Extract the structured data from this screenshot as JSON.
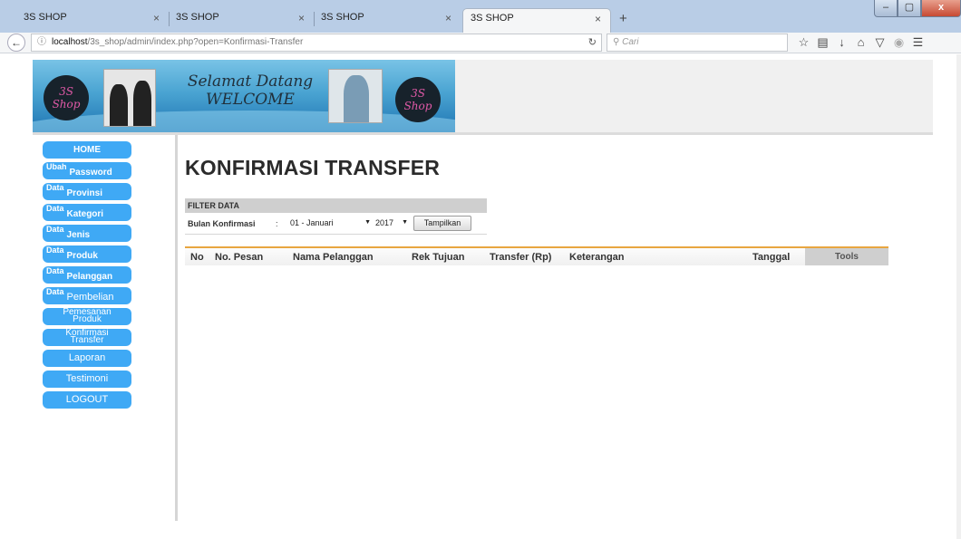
{
  "browser": {
    "tabs": [
      {
        "title": "3S SHOP",
        "close": "×"
      },
      {
        "title": "3S SHOP",
        "close": "×"
      },
      {
        "title": "3S SHOP",
        "close": "×"
      },
      {
        "title": "3S SHOP",
        "close": "×"
      }
    ],
    "new_tab": "+",
    "window_buttons": {
      "minimize": "–",
      "maximize": "▢",
      "close": "x"
    },
    "url_host": "localhost",
    "url_path": "/3s_shop/admin/index.php?open=Konfirmasi-Transfer",
    "search_placeholder": "Cari",
    "icons": [
      "back-icon",
      "info-icon",
      "reload-icon",
      "search-icon",
      "star-icon",
      "bookmarks-icon",
      "download-icon",
      "home-icon",
      "pocket-icon",
      "extension-icon",
      "menu-icon"
    ]
  },
  "banner": {
    "logo_text_line1": "3S",
    "logo_text_line2": "Shop",
    "welcome_line1": "Selamat Datang",
    "welcome_line2": "WELCOME"
  },
  "sidebar": {
    "items": [
      {
        "label": "HOME"
      },
      {
        "pre": "Ubah",
        "main": "Password"
      },
      {
        "pre": "Data",
        "main": "Provinsi"
      },
      {
        "pre": "Data",
        "main": "Kategori"
      },
      {
        "pre": "Data",
        "main": "Jenis"
      },
      {
        "pre": "Data",
        "main": "Produk"
      },
      {
        "pre": "Data",
        "main": "Pelanggan"
      },
      {
        "pre": "Data",
        "main": "Pembelian"
      },
      {
        "line1": "Pemesanan",
        "line2": "Produk"
      },
      {
        "line1": "Konfirmasi",
        "line2": "Transfer"
      },
      {
        "label": "Laporan"
      },
      {
        "label": "Testimoni"
      },
      {
        "label": "LOGOUT"
      }
    ]
  },
  "main": {
    "title": "KONFIRMASI TRANSFER",
    "filter": {
      "header": "FILTER DATA",
      "label": "Bulan Konfirmasi",
      "colon": ":",
      "month_value": "01 - Januari",
      "year_value": "2017",
      "button": "Tampilkan"
    },
    "table": {
      "columns": [
        "No",
        "No. Pesan",
        "Nama Pelanggan",
        "Rek Tujuan",
        "Transfer (Rp)",
        "Keterangan",
        "Tanggal",
        "Tools"
      ],
      "rows": []
    }
  },
  "colors": {
    "sidebar_button": "#3fa9f5",
    "table_accent": "#e8a640",
    "banner_blue": "#4aa4d2"
  }
}
